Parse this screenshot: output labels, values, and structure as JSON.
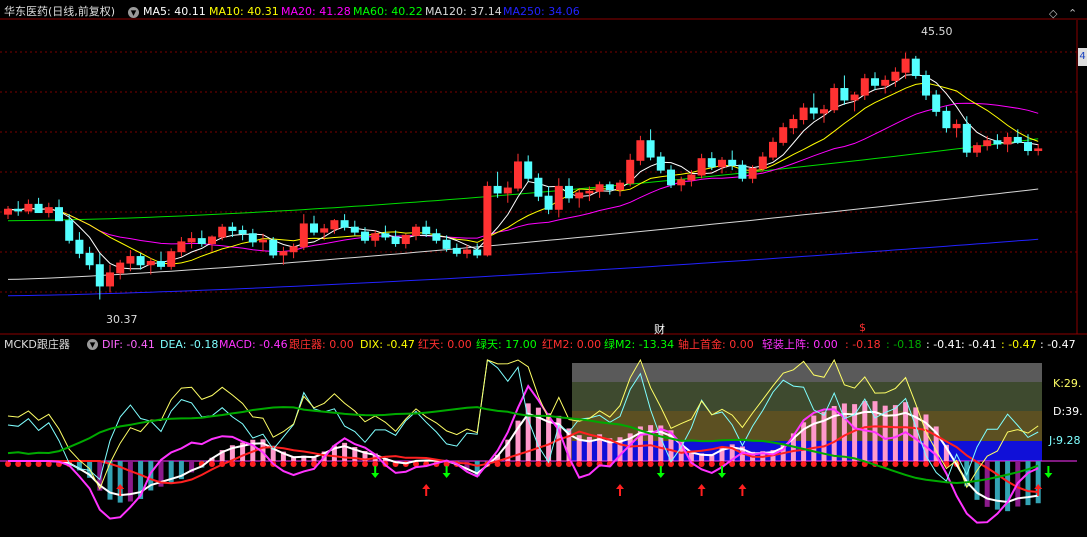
{
  "header": {
    "stock_name": "华东医药(日线,前复权)",
    "ma": [
      {
        "label": "MA5: 40.11",
        "color": "#ffffff"
      },
      {
        "label": "MA10: 40.31",
        "color": "#ffff00"
      },
      {
        "label": "MA20: 41.28",
        "color": "#ff00ff"
      },
      {
        "label": "MA60: 40.22",
        "color": "#00ff00"
      },
      {
        "label": "MA120: 37.14",
        "color": "#d8d8d8"
      },
      {
        "label": "MA250: 34.06",
        "color": "#2222ff"
      }
    ]
  },
  "main_chart": {
    "high_label": "45.50",
    "low_label": "30.37",
    "marker_cai": "财",
    "marker_s": "$",
    "right_tab": "4",
    "ylim": [
      28.5,
      47.5
    ]
  },
  "indicator": {
    "name": "MCKD跟庄器",
    "values": [
      {
        "label": "DIF: -0.41",
        "color": "#ff66ff"
      },
      {
        "label": "DEA: -0.18",
        "color": "#7fffff"
      },
      {
        "label": "MACD: -0.46",
        "color": "#ff33ff"
      },
      {
        "label": "跟庄器: 0.00",
        "color": "#ff3030"
      },
      {
        "label": "DIX: -0.47",
        "color": "#ffff00"
      },
      {
        "label": "红天: 0.00",
        "color": "#ff3030"
      },
      {
        "label": "绿天: 17.00",
        "color": "#00ff00"
      },
      {
        "label": "红M2: 0.00",
        "color": "#ff3030"
      },
      {
        "label": "绿M2: -13.34",
        "color": "#00ff00"
      },
      {
        "label": "轴上首金: 0.00",
        "color": "#ff3030"
      },
      {
        "label": "轻装上阵: 0.00",
        "color": "#ff33ff"
      },
      {
        "label": ": -0.18",
        "color": "#ff3030"
      },
      {
        "label": ": -0.18",
        "color": "#00aa00"
      },
      {
        "label": ": -0.41",
        "color": "#ffffff"
      },
      {
        "label": ": -0.41",
        "color": "#ffffff"
      },
      {
        "label": ": -0.47",
        "color": "#ffff00"
      },
      {
        "label": ": -0.47",
        "color": "#ffffff"
      }
    ],
    "kdj": {
      "k": "K:29.",
      "d": "D:39.",
      "j": "J:9.28"
    }
  },
  "chart_data": {
    "type": "candlestick",
    "title": "华东医药(日线,前复权)",
    "ylim": [
      28.5,
      47.5
    ],
    "ohlc": [
      [
        35.6,
        36.1,
        35.3,
        35.9
      ],
      [
        35.9,
        36.4,
        35.5,
        35.8
      ],
      [
        35.8,
        36.5,
        35.6,
        36.2
      ],
      [
        36.2,
        36.6,
        35.9,
        35.7
      ],
      [
        35.7,
        36.3,
        35.4,
        36.0
      ],
      [
        36.0,
        36.5,
        35.6,
        35.2
      ],
      [
        35.2,
        35.6,
        33.8,
        34.0
      ],
      [
        34.0,
        34.5,
        32.9,
        33.2
      ],
      [
        33.2,
        33.6,
        32.2,
        32.5
      ],
      [
        32.5,
        33.2,
        30.37,
        31.2
      ],
      [
        31.2,
        32.5,
        30.8,
        32.0
      ],
      [
        32.0,
        32.8,
        31.6,
        32.6
      ],
      [
        32.6,
        33.4,
        32.1,
        33.0
      ],
      [
        33.0,
        33.2,
        32.2,
        32.5
      ],
      [
        32.5,
        32.9,
        31.9,
        32.7
      ],
      [
        32.7,
        33.3,
        32.2,
        32.4
      ],
      [
        32.4,
        33.5,
        32.2,
        33.3
      ],
      [
        33.3,
        34.2,
        33.0,
        33.9
      ],
      [
        33.9,
        34.5,
        33.5,
        34.1
      ],
      [
        34.1,
        34.6,
        33.6,
        33.8
      ],
      [
        33.8,
        34.3,
        33.3,
        34.2
      ],
      [
        34.2,
        35.0,
        34.0,
        34.8
      ],
      [
        34.8,
        35.1,
        34.2,
        34.6
      ],
      [
        34.6,
        34.9,
        34.0,
        34.4
      ],
      [
        34.4,
        34.7,
        33.6,
        33.9
      ],
      [
        33.9,
        34.4,
        33.3,
        34.0
      ],
      [
        34.0,
        34.2,
        32.9,
        33.1
      ],
      [
        33.1,
        33.6,
        32.5,
        33.3
      ],
      [
        33.3,
        33.8,
        32.9,
        33.6
      ],
      [
        33.6,
        35.6,
        33.4,
        35.0
      ],
      [
        35.0,
        35.5,
        34.3,
        34.5
      ],
      [
        34.5,
        35.0,
        34.0,
        34.7
      ],
      [
        34.7,
        35.3,
        34.4,
        35.2
      ],
      [
        35.2,
        35.6,
        34.6,
        34.8
      ],
      [
        34.8,
        35.2,
        34.3,
        34.5
      ],
      [
        34.5,
        34.8,
        33.8,
        34.0
      ],
      [
        34.0,
        34.6,
        33.6,
        34.4
      ],
      [
        34.4,
        34.9,
        34.0,
        34.2
      ],
      [
        34.2,
        34.6,
        33.6,
        33.8
      ],
      [
        33.8,
        34.4,
        33.5,
        34.3
      ],
      [
        34.3,
        35.0,
        34.0,
        34.8
      ],
      [
        34.8,
        35.2,
        34.2,
        34.4
      ],
      [
        34.4,
        34.7,
        33.8,
        34.0
      ],
      [
        34.0,
        34.3,
        33.3,
        33.5
      ],
      [
        33.5,
        33.8,
        33.0,
        33.2
      ],
      [
        33.2,
        33.7,
        32.9,
        33.4
      ],
      [
        33.4,
        33.8,
        32.9,
        33.1
      ],
      [
        33.1,
        37.6,
        33.0,
        37.3
      ],
      [
        37.3,
        38.2,
        36.6,
        36.9
      ],
      [
        36.9,
        37.6,
        36.3,
        37.2
      ],
      [
        37.2,
        39.3,
        37.0,
        38.8
      ],
      [
        38.8,
        39.2,
        37.6,
        37.8
      ],
      [
        37.8,
        38.1,
        36.4,
        36.7
      ],
      [
        36.7,
        37.3,
        35.6,
        35.9
      ],
      [
        35.9,
        37.8,
        35.4,
        37.3
      ],
      [
        37.3,
        37.8,
        36.3,
        36.6
      ],
      [
        36.6,
        37.1,
        36.0,
        36.9
      ],
      [
        36.9,
        37.3,
        36.4,
        37.0
      ],
      [
        37.0,
        37.6,
        36.6,
        37.4
      ],
      [
        37.4,
        37.6,
        36.8,
        37.1
      ],
      [
        37.1,
        37.7,
        36.7,
        37.5
      ],
      [
        37.5,
        39.3,
        37.3,
        38.9
      ],
      [
        38.9,
        40.4,
        38.6,
        40.1
      ],
      [
        40.1,
        40.8,
        38.9,
        39.1
      ],
      [
        39.1,
        39.4,
        38.1,
        38.3
      ],
      [
        38.3,
        38.6,
        37.2,
        37.4
      ],
      [
        37.4,
        37.9,
        37.0,
        37.7
      ],
      [
        37.7,
        38.3,
        37.3,
        38.0
      ],
      [
        38.0,
        39.3,
        37.8,
        39.0
      ],
      [
        39.0,
        39.4,
        38.3,
        38.5
      ],
      [
        38.5,
        39.1,
        38.1,
        38.9
      ],
      [
        38.9,
        39.5,
        38.3,
        38.6
      ],
      [
        38.6,
        38.9,
        37.6,
        37.8
      ],
      [
        37.8,
        38.6,
        37.5,
        38.4
      ],
      [
        38.4,
        39.4,
        38.2,
        39.1
      ],
      [
        39.1,
        40.3,
        38.9,
        40.0
      ],
      [
        40.0,
        41.2,
        39.8,
        40.9
      ],
      [
        40.9,
        41.7,
        40.5,
        41.4
      ],
      [
        41.4,
        42.4,
        41.1,
        42.1
      ],
      [
        42.1,
        43.0,
        41.4,
        41.8
      ],
      [
        41.8,
        42.3,
        41.2,
        42.0
      ],
      [
        42.0,
        43.6,
        41.8,
        43.3
      ],
      [
        43.3,
        44.1,
        42.3,
        42.6
      ],
      [
        42.6,
        43.1,
        41.9,
        42.9
      ],
      [
        42.9,
        44.2,
        42.6,
        43.9
      ],
      [
        43.9,
        44.3,
        43.2,
        43.5
      ],
      [
        43.5,
        44.1,
        43.0,
        43.8
      ],
      [
        43.8,
        44.6,
        43.4,
        44.3
      ],
      [
        44.3,
        45.5,
        43.9,
        45.1
      ],
      [
        45.1,
        45.3,
        43.9,
        44.1
      ],
      [
        44.1,
        44.4,
        42.6,
        42.9
      ],
      [
        42.9,
        43.2,
        41.6,
        41.9
      ],
      [
        41.9,
        42.2,
        40.6,
        40.9
      ],
      [
        40.9,
        41.4,
        40.3,
        41.1
      ],
      [
        41.1,
        41.6,
        39.1,
        39.4
      ],
      [
        39.4,
        40.0,
        39.1,
        39.8
      ],
      [
        39.8,
        40.4,
        39.5,
        40.1
      ],
      [
        40.1,
        40.5,
        39.6,
        39.9
      ],
      [
        39.9,
        40.6,
        39.4,
        40.3
      ],
      [
        40.3,
        40.8,
        39.9,
        40.0
      ],
      [
        40.0,
        40.5,
        39.2,
        39.5
      ],
      [
        39.5,
        39.9,
        39.2,
        39.6
      ]
    ],
    "ma_series": [
      {
        "name": "MA5",
        "last": 40.11
      },
      {
        "name": "MA10",
        "last": 40.31
      },
      {
        "name": "MA20",
        "last": 41.28
      },
      {
        "name": "MA60",
        "last": 40.22
      },
      {
        "name": "MA120",
        "last": 37.14
      },
      {
        "name": "MA250",
        "last": 34.06
      }
    ],
    "annotations": {
      "high": 45.5,
      "low": 30.37
    },
    "indicator_last": {
      "DIF": -0.41,
      "DEA": -0.18,
      "MACD": -0.46,
      "DIX": -0.47,
      "绿天": 17.0,
      "绿M2": -13.34
    }
  }
}
